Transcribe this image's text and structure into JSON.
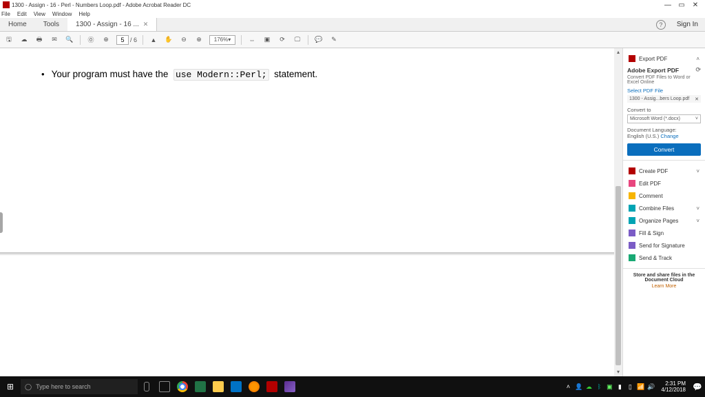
{
  "window": {
    "title": "1300 - Assign - 16 - Perl - Numbers Loop.pdf - Adobe Acrobat Reader DC"
  },
  "menubar": {
    "items": [
      "File",
      "Edit",
      "View",
      "Window",
      "Help"
    ]
  },
  "tabs": {
    "home": "Home",
    "tools": "Tools",
    "doc": "1300 - Assign - 16 ...",
    "signin": "Sign In"
  },
  "toolbar": {
    "page_current": "5",
    "page_sep": "/ 6",
    "zoom": "176%"
  },
  "document": {
    "line_pre": "Your program must have the",
    "line_code": "use Modern::Perl;",
    "line_post": "statement."
  },
  "rpanel": {
    "export_pdf": "Export PDF",
    "export_header": "Adobe Export PDF",
    "export_sub": "Convert PDF Files to Word or Excel Online",
    "select_label": "Select PDF File",
    "selected_file": "1300 - Assig...bers Loop.pdf",
    "convert_to": "Convert to",
    "convert_format": "Microsoft Word (*.docx)",
    "doclang_label": "Document Language:",
    "doclang_value": "English (U.S.)",
    "change": "Change",
    "convert_btn": "Convert",
    "create_pdf": "Create PDF",
    "edit_pdf": "Edit PDF",
    "comment": "Comment",
    "combine": "Combine Files",
    "organize": "Organize Pages",
    "fillsign": "Fill & Sign",
    "sendsig": "Send for Signature",
    "sendtrack": "Send & Track",
    "promo1": "Store and share files in the Document Cloud",
    "promo2": "Learn More"
  },
  "taskbar": {
    "search_placeholder": "Type here to search",
    "time": "2:31 PM",
    "date": "4/12/2018"
  }
}
